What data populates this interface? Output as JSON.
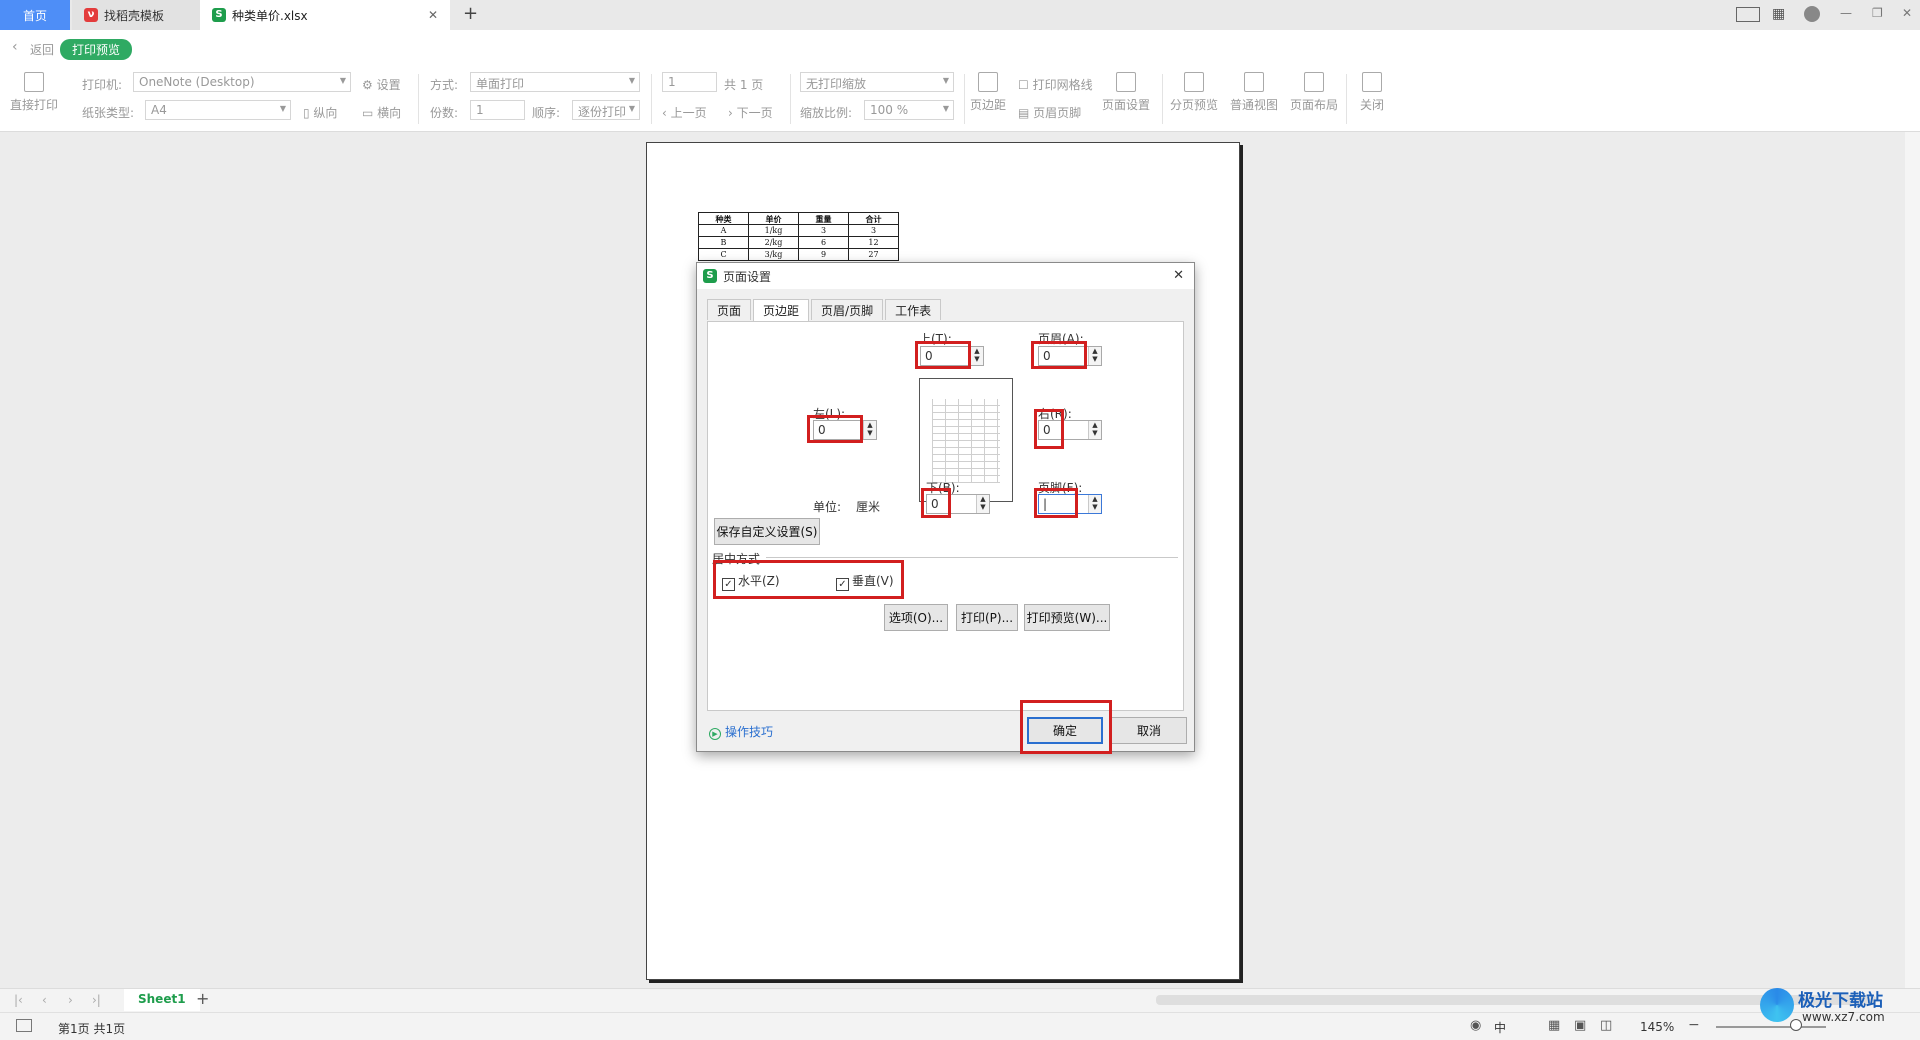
{
  "tabs": {
    "home": "首页",
    "template": "找稻壳模板",
    "file": "种类单价.xlsx",
    "add": "+"
  },
  "bar2": {
    "back": "返回",
    "preview_badge": "打印预览"
  },
  "toolbar": {
    "direct_print": "直接打印",
    "printer_label": "打印机:",
    "printer_value": "OneNote (Desktop)",
    "settings": "设置",
    "paper_label": "纸张类型:",
    "paper_value": "A4",
    "portrait": "纵向",
    "landscape": "横向",
    "mode_label": "方式:",
    "mode_value": "单面打印",
    "copies_label": "份数:",
    "copies_value": "1",
    "order_label": "顺序:",
    "order_value": "逐份打印",
    "page_value": "1",
    "total_pages": "共 1 页",
    "prev_page": "上一页",
    "next_page": "下一页",
    "scale_mode": "无打印缩放",
    "scale_label": "缩放比例:",
    "scale_value": "100 %",
    "margins": "页边距",
    "gridlines": "打印网格线",
    "header_footer": "页眉页脚",
    "page_setup": "页面设置",
    "page_break": "分页预览",
    "normal_view": "普通视图",
    "page_layout": "页面布局",
    "close": "关闭"
  },
  "mini_table": {
    "headers": [
      "种类",
      "单价",
      "重量",
      "合计"
    ],
    "rows": [
      [
        "A",
        "1/kg",
        "3",
        "3"
      ],
      [
        "B",
        "2/kg",
        "6",
        "12"
      ],
      [
        "C",
        "3/kg",
        "9",
        "27"
      ]
    ]
  },
  "dialog": {
    "title": "页面设置",
    "close": "✕",
    "tabs": [
      "页面",
      "页边距",
      "页眉/页脚",
      "工作表"
    ],
    "top_label": "上(T):",
    "top_value": "0",
    "header_label": "页眉(A):",
    "header_value": "0",
    "left_label": "左(L):",
    "left_value": "0",
    "right_label": "右(R):",
    "right_value": "0",
    "bottom_label": "下(B):",
    "bottom_value": "0",
    "footer_label": "页脚(F):",
    "footer_value": "",
    "unit_label": "单位:",
    "unit_value": "厘米",
    "save_custom": "保存自定义设置(S)",
    "center_section": "居中方式",
    "horizontal": "水平(Z)",
    "vertical": "垂直(V)",
    "options": "选项(O)...",
    "print": "打印(P)...",
    "print_preview": "打印预览(W)...",
    "tips": "操作技巧",
    "ok": "确定",
    "cancel": "取消"
  },
  "sheetbar": {
    "sheet_name": "Sheet1",
    "add": "+"
  },
  "statusbar": {
    "page_info": "第1页 共1页",
    "zoom": "145%",
    "lang": "中"
  },
  "watermark": {
    "text": "极光下载站",
    "url": "www.xz7.com"
  },
  "colors": {
    "accent_blue": "#4e8ef7",
    "preview_green": "#2faa63",
    "highlight_red": "#d21f1f",
    "sheet_green": "#1e9d4c"
  }
}
